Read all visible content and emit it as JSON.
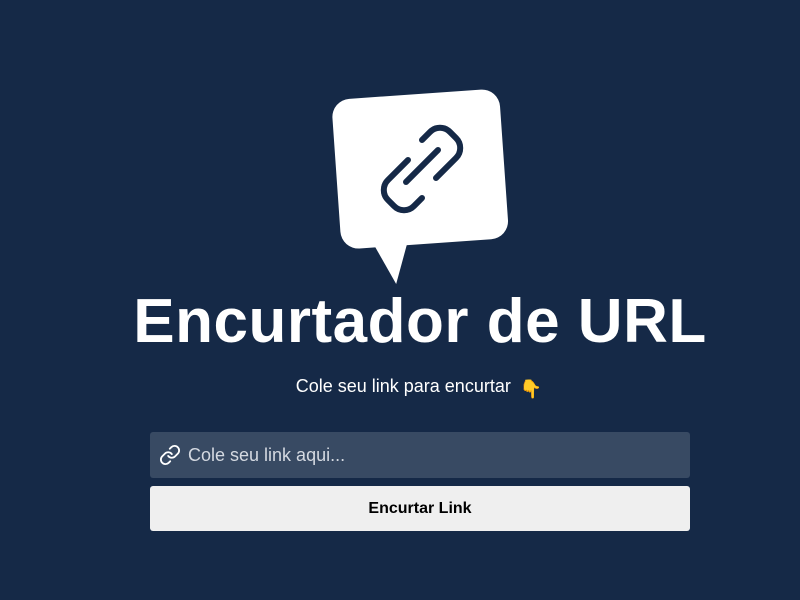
{
  "header": {
    "logo_icon": "chain-link-speech-bubble-icon",
    "title": "Encurtador de URL",
    "subtitle": "Cole seu link para encurtar",
    "subtitle_emoji": "👇"
  },
  "form": {
    "input_icon": "link-icon",
    "input_value": "",
    "input_placeholder": "Cole seu link aqui...",
    "button_label": "Encurtar Link"
  },
  "colors": {
    "background": "#152947",
    "input_background": "#384a63",
    "button_background": "#efefef",
    "text": "#ffffff"
  }
}
